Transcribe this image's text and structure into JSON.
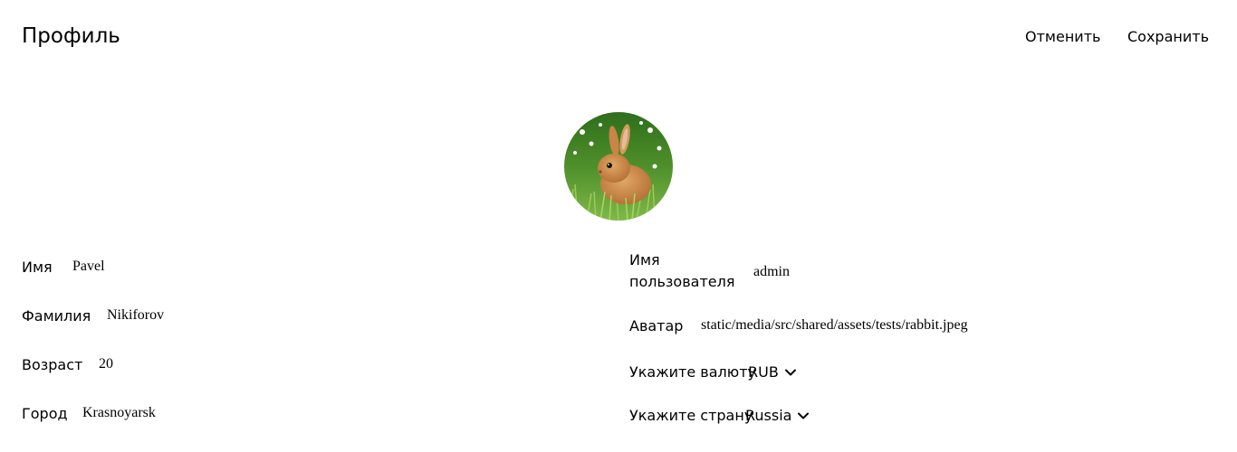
{
  "header": {
    "title": "Профиль",
    "cancel_label": "Отменить",
    "save_label": "Сохранить"
  },
  "avatar": {
    "icon": "rabbit-avatar-image",
    "colors": {
      "grass": "#4e9a2e",
      "fur": "#c9894a",
      "flowers": "#ffffff"
    }
  },
  "form": {
    "first_name": {
      "label": "Имя",
      "value": "Pavel"
    },
    "last_name": {
      "label": "Фамилия",
      "value": "Nikiforov"
    },
    "age": {
      "label": "Возраст",
      "value": "20"
    },
    "city": {
      "label": "Город",
      "value": "Krasnoyarsk"
    },
    "username": {
      "label_line1": "Имя",
      "label_line2": "пользователя",
      "value": "admin"
    },
    "avatar_path": {
      "label": "Аватар",
      "value": "static/media/src/shared/assets/tests/rabbit.jpeg"
    },
    "currency": {
      "label": "Укажите валюту",
      "value": "RUB"
    },
    "country": {
      "label": "Укажите страну",
      "value": "Russia"
    }
  }
}
